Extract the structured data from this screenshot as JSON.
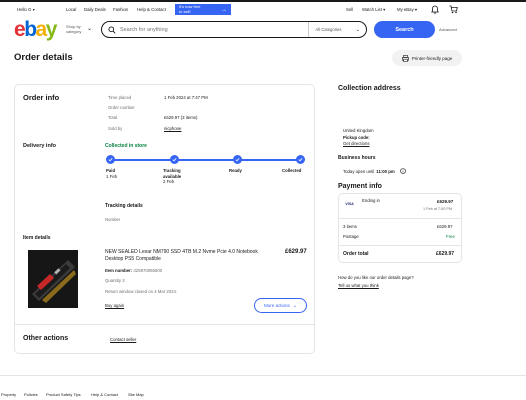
{
  "header": {
    "greeting": "Hello G",
    "nav": [
      "Local",
      "Daily Deals",
      "Fashion",
      "Help & Contact"
    ],
    "promo_line1": "It's now free",
    "promo_line2": "to sell!",
    "sell": "Sell",
    "watch_list": "Watch List",
    "my_ebay": "My eBay",
    "logo": [
      "e",
      "b",
      "a",
      "y"
    ],
    "logo_colors": [
      "#e53238",
      "#0064d2",
      "#f5af02",
      "#86b817"
    ],
    "shop_by": "Shop by",
    "category": "category",
    "search_placeholder": "Search for anything",
    "all_categories": "All Categories",
    "search_button": "Search",
    "advanced": "Advanced"
  },
  "page": {
    "title": "Order details",
    "printer_friendly": "Printer-friendly page"
  },
  "order_info": {
    "heading": "Order info",
    "rows": [
      {
        "label": "Time placed",
        "value": "1 Feb 2024 at 7:47 PM"
      },
      {
        "label": "Order number",
        "value": ""
      },
      {
        "label": "Total",
        "value": "£629.97 (3 items)"
      },
      {
        "label": "Sold by",
        "value": "nicphone"
      }
    ]
  },
  "delivery": {
    "heading": "Delivery info",
    "status": "Collected in store",
    "steps": [
      {
        "label": "Paid",
        "sub": "1 Feb"
      },
      {
        "label": "Tracking available",
        "sub": "2 Feb"
      },
      {
        "label": "Ready",
        "sub": ""
      },
      {
        "label": "Collected",
        "sub": ""
      }
    ],
    "progress": 1.0,
    "tracking_heading": "Tracking details",
    "number_label": "Number"
  },
  "item": {
    "heading": "Item details",
    "title": "NEW SEALED Lexar NM790 SSD 4TB M.2 Nvme Pcie 4.0 Notebook Desktop PS5 Compatible",
    "price": "£629.97",
    "item_number_label": "Item number:",
    "item_number": "325970066500",
    "quantity": "Quantity 3",
    "return_note": "Return window closed on 4 Mar 2024.",
    "buy_again": "Buy again",
    "more_actions": "More actions"
  },
  "other_actions": {
    "heading": "Other actions",
    "contact_seller": "Contact seller"
  },
  "collection": {
    "heading": "Collection address",
    "country": "United Kingdom",
    "pickup_code": "Pickup code:",
    "directions": "Get directions",
    "hours_heading": "Business hours",
    "hours_text": "Today open until",
    "hours_time": "11:00 pm"
  },
  "payment": {
    "heading": "Payment info",
    "card_brand": "VISA",
    "ending_in": "Ending in",
    "amount": "£629.97",
    "date": "1 Feb at 7:50 PM",
    "items_label": "3 items",
    "items_value": "£629.97",
    "postage_label": "Postage",
    "postage_value": "Free",
    "total_label": "Order total",
    "total_value": "£629.97",
    "feedback_question": "How do you like our order details page?",
    "feedback_link": "Tell us what you think"
  },
  "footer": {
    "links": [
      "Property",
      "Policies",
      "Product Safety Tips",
      "Help & Contact",
      "Site Map"
    ]
  },
  "colors": {
    "accent": "#3665f3",
    "success": "#05823f",
    "promo": "#3665f3"
  }
}
